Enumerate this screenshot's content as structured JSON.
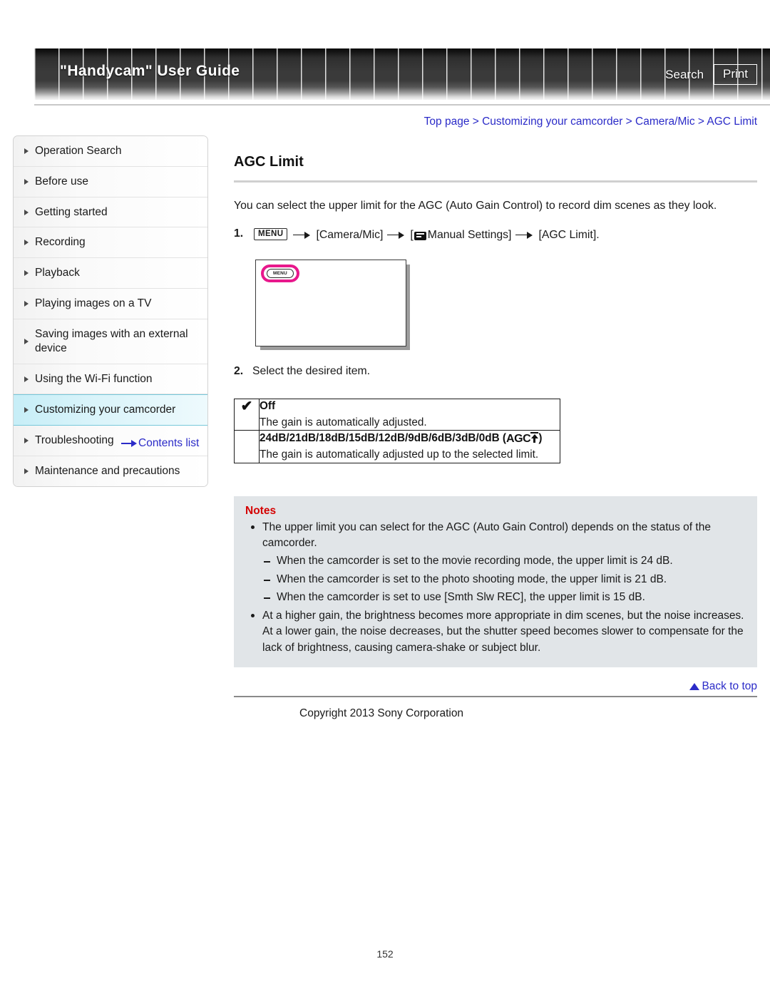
{
  "header": {
    "title": "\"Handycam\" User Guide",
    "search_label": "Search",
    "print_label": "Print"
  },
  "breadcrumb": {
    "text": "Top page > Customizing your camcorder > Camera/Mic > AGC Limit"
  },
  "sidebar": {
    "items": [
      {
        "label": "Operation Search",
        "active": false
      },
      {
        "label": "Before use",
        "active": false
      },
      {
        "label": "Getting started",
        "active": false
      },
      {
        "label": "Recording",
        "active": false
      },
      {
        "label": "Playback",
        "active": false
      },
      {
        "label": "Playing images on a TV",
        "active": false
      },
      {
        "label": "Saving images with an external device",
        "active": false
      },
      {
        "label": "Using the Wi-Fi function",
        "active": false
      },
      {
        "label": "Customizing your camcorder",
        "active": true
      },
      {
        "label": "Troubleshooting",
        "active": false
      },
      {
        "label": "Maintenance and precautions",
        "active": false
      }
    ],
    "contents_link": "Contents list"
  },
  "main": {
    "page_title": "AGC Limit",
    "intro": "You can select the upper limit for the AGC (Auto Gain Control) to record dim scenes as they look.",
    "step1": {
      "number": "1.",
      "menu_chip": "MENU",
      "part1": "[Camera/Mic]",
      "part2_open": "[",
      "part2": "Manual Settings]",
      "part3": "[AGC Limit]."
    },
    "illustration": {
      "menu_button_label": "MENU"
    },
    "step2": {
      "number": "2.",
      "text": "Select the desired item."
    },
    "options": [
      {
        "checked": true,
        "check_glyph": "✔",
        "name": "Off",
        "desc": "The gain is automatically adjusted.",
        "badge": ""
      },
      {
        "checked": false,
        "check_glyph": "",
        "name": "24dB/21dB/18dB/15dB/12dB/9dB/6dB/3dB/0dB",
        "desc": "The gain is automatically adjusted up to the selected limit.",
        "badge": "AGC"
      }
    ],
    "notes": {
      "title": "Notes",
      "items": [
        {
          "type": "bullet",
          "text": "The upper limit you can select for the AGC (Auto Gain Control) depends on the status of the camcorder."
        },
        {
          "type": "sub",
          "text": "When the camcorder is set to the movie recording mode, the upper limit is 24 dB."
        },
        {
          "type": "sub",
          "text": "When the camcorder is set to the photo shooting mode, the upper limit is 21 dB."
        },
        {
          "type": "sub",
          "text": "When the camcorder is set to use [Smth Slw REC], the upper limit is 15 dB."
        },
        {
          "type": "bullet",
          "text": "At a higher gain, the brightness becomes more appropriate in dim scenes, but the noise increases. At a lower gain, the noise decreases, but the shutter speed becomes slower to compensate for the lack of brightness, causing camera-shake or subject blur."
        }
      ]
    },
    "back_to_top": "Back to top",
    "copyright": "Copyright 2013 Sony Corporation"
  },
  "page_number": "152",
  "colors": {
    "link": "#2b2bc8",
    "notes_title": "#d40000",
    "notes_bg": "#e1e5e8",
    "highlight": "#c7eef7",
    "menu_highlight": "#e8188c"
  }
}
